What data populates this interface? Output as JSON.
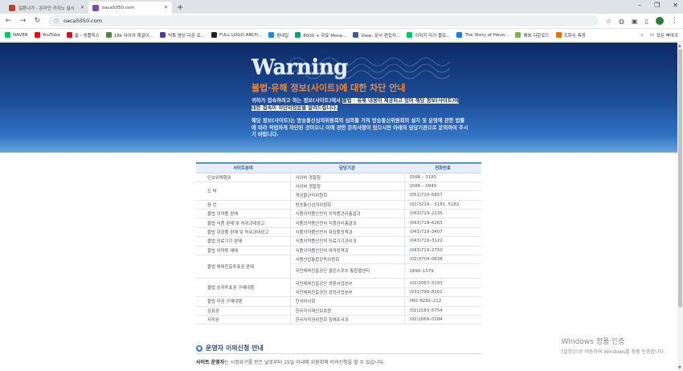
{
  "browser": {
    "tabs": [
      {
        "title": "일론나가 - 온라인 카지노 실시",
        "favicon_color": "#b1452f",
        "active": false
      },
      {
        "title": "oaca5050.com",
        "favicon_color": "#7b4ab8",
        "active": true
      }
    ],
    "new_tab_label": "+",
    "url": "oaca5050.com",
    "bookmarks": [
      {
        "label": "NAVER",
        "color": "#03c75a"
      },
      {
        "label": "YouTube",
        "color": "#ff0000"
      },
      {
        "label": "홈 - 넷플릭스",
        "color": "#e50914"
      },
      {
        "label": "18k 다이아 목걸이...",
        "color": "#4a8a3c"
      },
      {
        "label": "릭톡 영상 다운 로...",
        "color": "#4b3ab8"
      },
      {
        "label": "FULL LOGO ARCH...",
        "color": "#222222"
      },
      {
        "label": "썸네일",
        "color": "#1e88e5"
      },
      {
        "label": "8000 + 무료 Mone...",
        "color": "#00a86b"
      },
      {
        "label": "View, 문서 편집자...",
        "color": "#3b5998"
      },
      {
        "label": "이미지 미기 블로...",
        "color": "#03c75a"
      },
      {
        "label": "The Story of Heun...",
        "color": "#1877f2"
      },
      {
        "label": "해복 다운로드",
        "color": "#7cb342"
      },
      {
        "label": "조화수 측정",
        "color": "#ef6c00"
      }
    ],
    "all_bookmarks_label": "모든 북마크"
  },
  "banner": {
    "warning": "Warning",
    "subtitle": "불법·유해 정보(사이트)에 대한 차단 안내",
    "message1_pre": "귀하가 접속하려고 하는 정보(사이트)에서 ",
    "message1_highlight": "불법 · 유해 내용이 제공되고 있어 해당 정보(사이트)에 대한 접속이 차단되었음을 알려드립니다.",
    "message2": "해당 정보(사이트)는 방송통신심의위원회의 심의를 거쳐 방송통신위원회의 설치 및 운영에 관한 법률에 따라 적법하게 차단된 것이오니 이에 관한 문의사항이 있으시면 아래의 담당기관으로 문의하여 주시기 바랍니다."
  },
  "table": {
    "headers": [
      "사이트분야",
      "담당기관",
      "전화번호"
    ],
    "rows": [
      {
        "field": "인보위해행위",
        "agency": "사이버 경찰청",
        "phone": "1566 – 0183"
      },
      {
        "field": "도 박",
        "agency": "사이버 경찰청",
        "phone": "1566 – 0943"
      },
      {
        "field": "",
        "agency": "게임물관리위원회",
        "phone": "(051)720–6857"
      },
      {
        "field": "음 란",
        "agency": "방송통신심의위원회",
        "phone": "(02)3219 – 5181, 5182"
      },
      {
        "field": "불법 의약품 판매",
        "agency": "식품의약품안전처 의약품관리총괄과",
        "phone": "(043)719–2135"
      },
      {
        "field": "불법 식품 판매 및 허위과대광고",
        "agency": "식품의약품안전처 식품관리총괄과",
        "phone": "(043)719–6263"
      },
      {
        "field": "불법 화장품 판매 및 허위과대광고",
        "agency": "식품의약품안전처 화장품정책과",
        "phone": "(043)719–3407"
      },
      {
        "field": "불법 의료기기 판매",
        "agency": "식품의약품안전처 의료기기관리과",
        "phone": "(043)719–3122"
      },
      {
        "field": "불법 마약류 매매",
        "agency": "식품의약품안전처 마약정책과",
        "phone": "(043)719–2750"
      },
      {
        "field": "불법 체육진흥투표권 판매",
        "agency": "사행산업통합감독위원회",
        "phone": "(02)3704–0638"
      },
      {
        "field": "",
        "agency": "국민체육진흥공단 클린스포츠 통합콜센터",
        "phone": "1899–1579"
      },
      {
        "field": "불법 승자투표권 구매대행",
        "agency": "국민체육진흥공단 경륜사업본부",
        "phone": "(02)2067–5193"
      },
      {
        "field": "",
        "agency": "국민체육진흥공단 경정사업본부",
        "phone": "(031)790–8161"
      },
      {
        "field": "불법 마권 구매대행",
        "agency": "한국마사회",
        "phone": "080–8282–212"
      },
      {
        "field": "상표권",
        "agency": "한국지식재산보호원",
        "phone": "(02)2183–5754"
      },
      {
        "field": "저작권",
        "agency": "한국저작권위원회 침해조사과",
        "phone": "(02)2669–0184"
      }
    ]
  },
  "section": {
    "icon": "●",
    "title": "운영자 이의신청 안내",
    "operator_label": "사이트 운영자",
    "operator_text": "는 시정요구를 받은 날로부터 15일 이내에 위원회에 이의신청을 할 수 있습니다."
  },
  "watermark": {
    "line1": "Windows 정품 인증",
    "line2": "[설정]으로 이동하여 Windows를 정품 인증합니다."
  }
}
